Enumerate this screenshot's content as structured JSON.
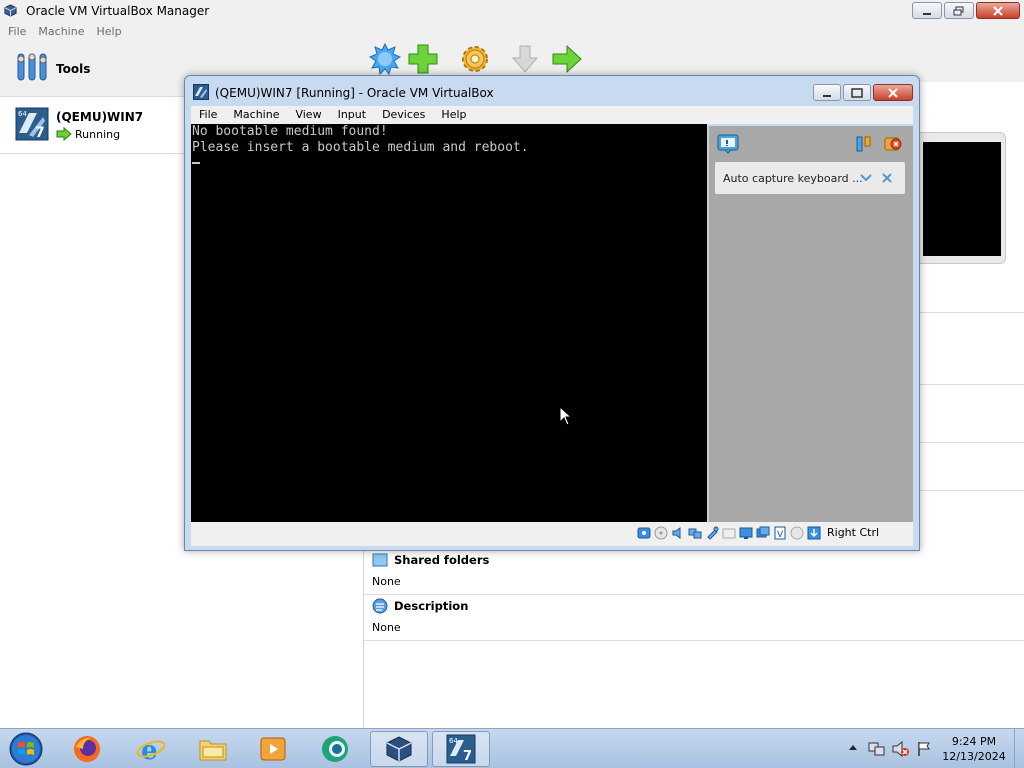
{
  "manager": {
    "title": "Oracle VM VirtualBox Manager",
    "menu": [
      "File",
      "Machine",
      "Help"
    ],
    "sidebar": {
      "tools_label": "Tools",
      "vm": {
        "name": "(QEMU)WIN7",
        "state": "Running",
        "badge": "64",
        "version_digit": "7"
      }
    },
    "toolbar": [
      "new-icon",
      "add-icon",
      "settings-icon",
      "discard-icon",
      "start-icon"
    ],
    "details": {
      "shared_folders": {
        "header": "Shared folders",
        "value": "None"
      },
      "description": {
        "header": "Description",
        "value": "None"
      }
    }
  },
  "vm_window": {
    "title": "(QEMU)WIN7 [Running] - Oracle VM VirtualBox",
    "menu": [
      "File",
      "Machine",
      "View",
      "Input",
      "Devices",
      "Help"
    ],
    "console_lines": [
      "No bootable medium found!",
      "Please insert a bootable medium and reboot."
    ],
    "notification": "Auto capture keyboard ...",
    "host_key": "Right Ctrl"
  },
  "taskbar": {
    "clock_time": "9:24 PM",
    "clock_date": "12/13/2024"
  },
  "colors": {
    "accent_green": "#4caf1e",
    "titlebar_blue": "#c7daf0",
    "console_bg": "#000000"
  }
}
